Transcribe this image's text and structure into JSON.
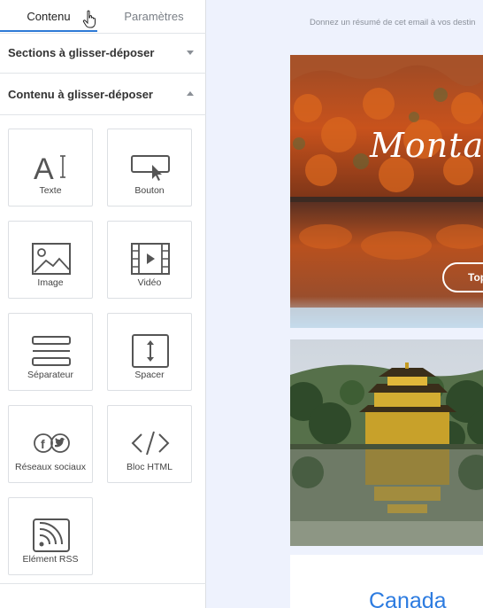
{
  "sidebar": {
    "tabs": [
      {
        "label": "Contenu"
      },
      {
        "label": "Paramètres"
      }
    ],
    "sections": [
      {
        "label": "Sections à glisser-déposer",
        "caret": "chevron-down-icon"
      },
      {
        "label": "Contenu à glisser-déposer",
        "caret": "chevron-up-icon"
      }
    ],
    "blocks": [
      {
        "label": "Texte",
        "icon": "text-icon"
      },
      {
        "label": "Bouton",
        "icon": "button-icon"
      },
      {
        "label": "Image",
        "icon": "image-icon"
      },
      {
        "label": "Vidéo",
        "icon": "video-icon"
      },
      {
        "label": "Séparateur",
        "icon": "separator-icon"
      },
      {
        "label": "Spacer",
        "icon": "spacer-icon"
      },
      {
        "label": "Réseaux sociaux",
        "icon": "social-icon"
      },
      {
        "label": "Bloc HTML",
        "icon": "html-icon"
      },
      {
        "label": "Elément RSS",
        "icon": "rss-icon"
      }
    ]
  },
  "canvas": {
    "summary_placeholder": "Donnez un résumé de cet email à vos destin",
    "hero": {
      "title": "Montagn",
      "button_label": "Top"
    },
    "card3": {
      "title": "Canada"
    }
  },
  "colors": {
    "accent": "#2d7ad6",
    "canvas_bg": "#eef2fd",
    "title_blue": "#2c7be0"
  }
}
